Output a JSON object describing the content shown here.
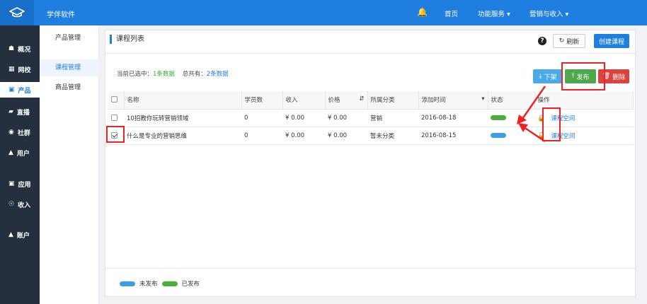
{
  "app": {
    "brand": "学伴软件"
  },
  "topnav": {
    "home": "首页",
    "features": "功能服务",
    "marketing": "营销与收入"
  },
  "sidebar": {
    "items": [
      {
        "label": "概况",
        "icon": "home-icon"
      },
      {
        "label": "网校",
        "icon": "school-icon"
      },
      {
        "label": "产品",
        "icon": "product-icon",
        "active": true
      },
      {
        "label": "直播",
        "icon": "live-icon"
      },
      {
        "label": "社群",
        "icon": "group-icon"
      },
      {
        "label": "用户",
        "icon": "user-icon"
      },
      {
        "label": "应用",
        "icon": "app-icon"
      },
      {
        "label": "收入",
        "icon": "income-icon"
      },
      {
        "label": "账户",
        "icon": "account-icon"
      }
    ]
  },
  "subnav": {
    "header": "产品管理",
    "items": [
      {
        "label": "课程管理",
        "active": true
      },
      {
        "label": "商品管理"
      }
    ]
  },
  "main": {
    "title": "课程列表",
    "refresh_label": "刷新",
    "create_label": "创建课程",
    "selection": {
      "prefix": "当前已选中：",
      "selected": "1条数据",
      "total_prefix": "总共有：",
      "total": "2条数据"
    },
    "buttons": {
      "unpublish": "下架",
      "publish": "发布",
      "delete": "删除"
    },
    "columns": [
      "名称",
      "学员数",
      "收入",
      "价格",
      "所属分类",
      "添加时间",
      "状态",
      "操作"
    ],
    "rows": [
      {
        "name": "10招教你玩转营销领域",
        "students": "0",
        "income": "¥ 0.00",
        "price": "¥ 0.00",
        "category": "营销",
        "date": "2016-08-18",
        "status": "published",
        "checked": false,
        "action": "课程空间"
      },
      {
        "name": "什么是专业的营销思维",
        "students": "0",
        "income": "¥ 0.00",
        "price": "¥ 0.00",
        "category": "暂未分类",
        "date": "2016-08-15",
        "status": "unpublished",
        "checked": true,
        "action": "课程空间"
      }
    ],
    "legend": {
      "unpublished": "未发布",
      "published": "已发布"
    }
  },
  "colors": {
    "primary": "#1e7fe0",
    "published": "#4caf3c",
    "unpublished": "#3aa0e8",
    "delete": "#d9443e",
    "annotation": "#e22222"
  }
}
